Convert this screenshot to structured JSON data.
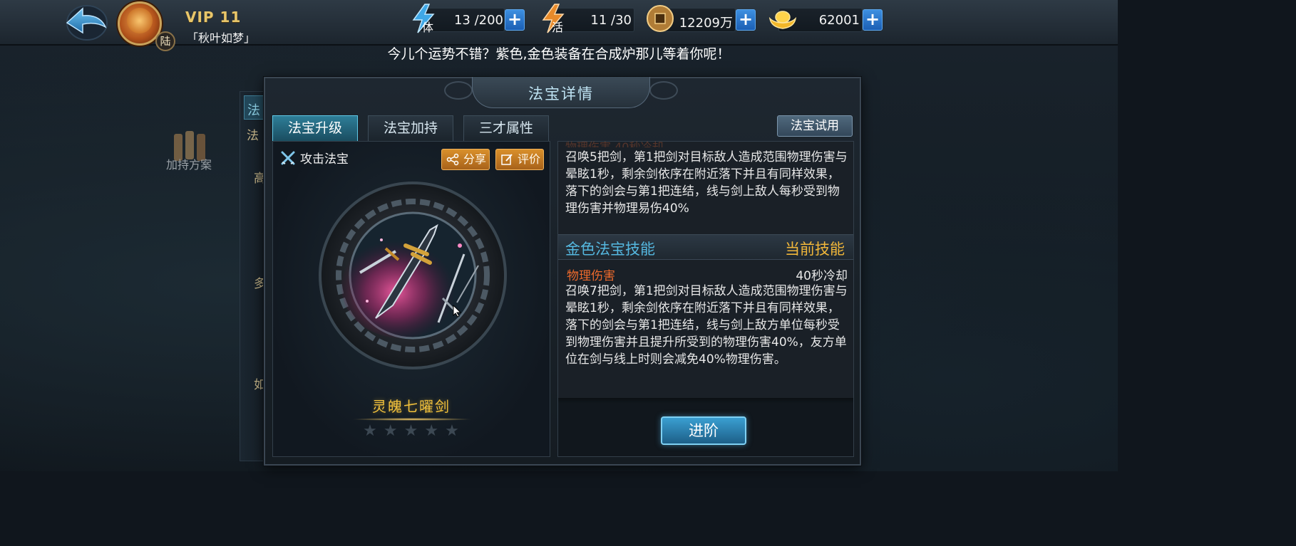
{
  "header": {
    "vip": "VIP 11",
    "player_name": "「秋叶如梦」",
    "avatar_badge": "陆",
    "resources": [
      {
        "name": "stamina",
        "icon_label": "体",
        "value": "13 /200"
      },
      {
        "name": "activity",
        "icon_label": "活",
        "value": "11  /30"
      },
      {
        "name": "copper",
        "value": "12209万"
      },
      {
        "name": "gold",
        "value": "62001"
      }
    ]
  },
  "notice": "今儿个运势不错？紫色,金色装备在合成炉那儿等着你呢！",
  "background": {
    "tab_char": "法",
    "side_chars": [
      "法",
      "高",
      "多",
      "如"
    ],
    "scroll_label": "加持方案"
  },
  "dialog": {
    "title": "法宝详情",
    "tabs": [
      "法宝升级",
      "法宝加持",
      "三才属性"
    ],
    "active_tab": 0,
    "trial_button": "法宝试用",
    "treasure": {
      "type_label": "攻击法宝",
      "share_label": "分享",
      "review_label": "评价",
      "name": "灵魄七曜剑",
      "stars_total": 5,
      "stars_filled": 0
    },
    "skills": {
      "prev_desc": "召唤5把剑，第1把剑对目标敌人造成范围物理伤害与晕眩1秒，剩余剑依序在附近落下并且有同样效果，落下的剑会与第1把连结，线与剑上敌人每秒受到物理伤害并物理易伤40%",
      "section_title": "金色法宝技能",
      "current_label": "当前技能",
      "skill_name": "物理伤害",
      "cooldown": "40秒冷却",
      "desc": "召唤7把剑，第1把剑对目标敌人造成范围物理伤害与晕眩1秒，剩余剑依序在附近落下并且有同样效果，落下的剑会与第1把连结，线与剑上敌方单位每秒受到物理伤害并且提升所受到的物理伤害40%，友方单位在剑与线上时则会减免40%物理伤害。"
    },
    "advance_button": "进阶"
  }
}
